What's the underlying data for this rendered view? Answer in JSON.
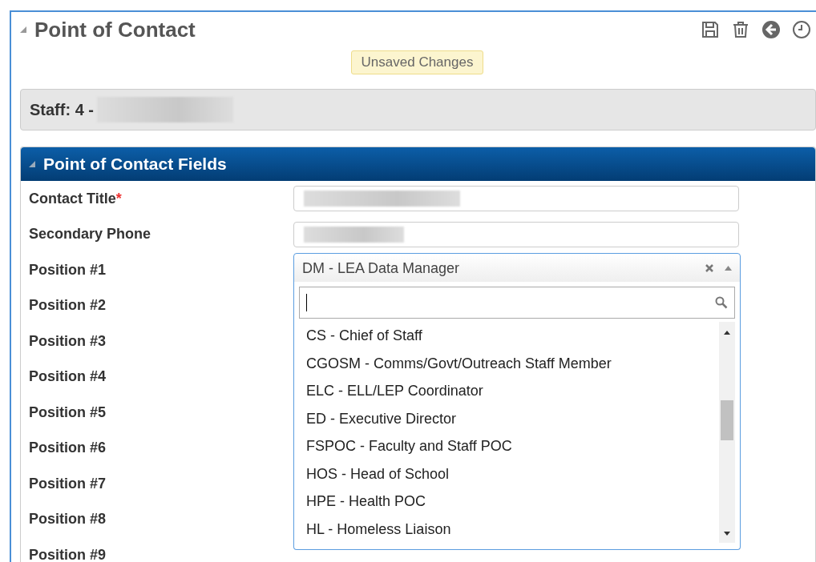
{
  "header": {
    "title": "Point of Contact",
    "expanded": true,
    "badge": "Unsaved Changes"
  },
  "staff_bar": {
    "label": "Staff: 4 -"
  },
  "section": {
    "title": "Point of Contact Fields",
    "expanded": true,
    "fields": [
      {
        "kind": "text",
        "label": "Contact Title",
        "required_mark": "*"
      },
      {
        "kind": "text",
        "label": "Secondary Phone"
      },
      {
        "kind": "select",
        "label": "Position #1",
        "value": "DM - LEA Data Manager",
        "open": true
      },
      {
        "kind": "label",
        "label": "Position #2"
      },
      {
        "kind": "label",
        "label": "Position #3"
      },
      {
        "kind": "label",
        "label": "Position #4"
      },
      {
        "kind": "label",
        "label": "Position #5"
      },
      {
        "kind": "label",
        "label": "Position #6"
      },
      {
        "kind": "label",
        "label": "Position #7"
      },
      {
        "kind": "label",
        "label": "Position #8"
      },
      {
        "kind": "label",
        "label": "Position #9"
      }
    ]
  },
  "dropdown": {
    "options": [
      "CS - Chief of Staff",
      "CGOSM - Comms/Govt/Outreach Staff Member",
      "ELC - ELL/LEP Coordinator",
      "ED - Executive Director",
      "FSPOC - Faculty and Staff POC",
      "HOS - Head of School",
      "HPE - Health POC",
      "HL - Homeless Liaison"
    ]
  }
}
